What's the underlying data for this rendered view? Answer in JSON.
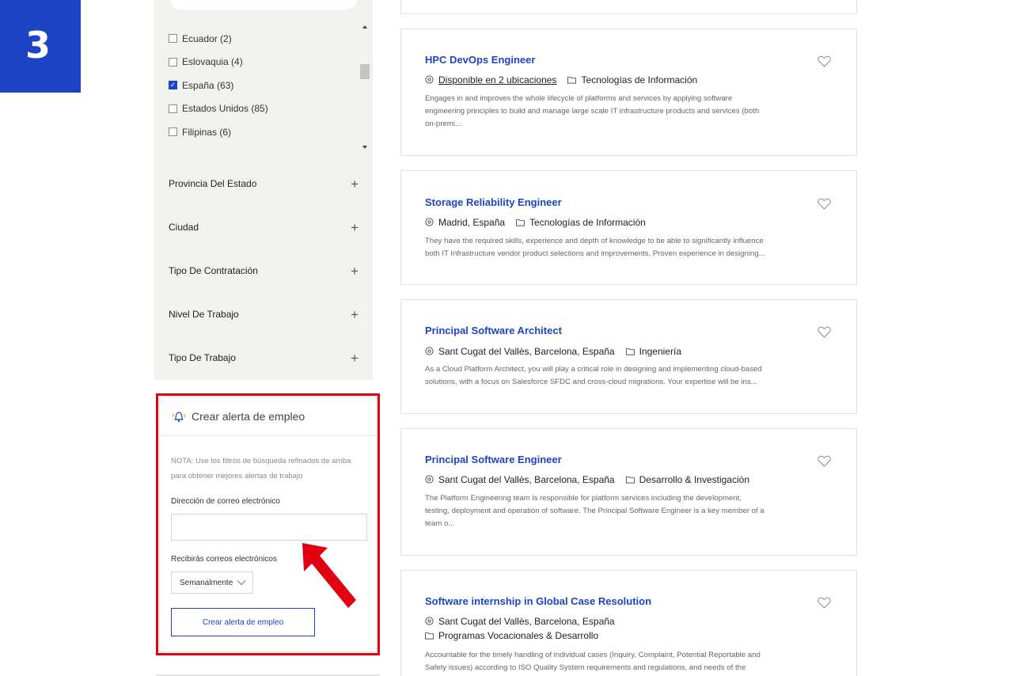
{
  "step_badge": "3",
  "countries": [
    {
      "label": "Ecuador (2)",
      "checked": false
    },
    {
      "label": "Eslovaquia (4)",
      "checked": false
    },
    {
      "label": "España (63)",
      "checked": true
    },
    {
      "label": "Estados Unidos (85)",
      "checked": false
    },
    {
      "label": "Filipinas (6)",
      "checked": false
    }
  ],
  "filters": [
    {
      "label": "Provincia Del Estado"
    },
    {
      "label": "Ciudad"
    },
    {
      "label": "Tipo De Contratación"
    },
    {
      "label": "Nivel De Trabajo"
    },
    {
      "label": "Tipo De Trabajo"
    }
  ],
  "alert": {
    "title": "Crear alerta de empleo",
    "note_line1": "NOTA: Use los filtros de búsqueda refinados de arriba",
    "note_line2": "para obtener mejores alertas de trabajo",
    "email_label": "Dirección de correo electrónico",
    "email_value": "",
    "frequency_label": "Recibirás correos electrónicos",
    "frequency_value": "Semanalmente",
    "button_label": "Crear alerta de empleo"
  },
  "jobs": [
    {
      "title": "HPC DevOps Engineer",
      "location": "Disponible en 2 ubicaciones",
      "category": "Tecnologías de Información",
      "desc": [
        "Engages in and improves the whole lifecycle of platforms and services by applying software",
        "engineering principles to build and manage large scale IT infrastructure products and services (both",
        "on-premi..."
      ]
    },
    {
      "title": "Storage Reliability Engineer",
      "location": "Madrid, España",
      "category": "Tecnologías de Información",
      "desc": [
        "They have the required skills, experience and depth of knowledge to be able to significantly influence",
        "both IT Infrastructure vendor product selections and improvements. Proven experience in designing..."
      ]
    },
    {
      "title": "Principal Software Architect",
      "location": "Sant Cugat del Vallès, Barcelona, España",
      "category": "Ingeniería",
      "desc": [
        "As a Cloud Platform Architect, you will play a critical role in designing and implementing cloud-based",
        "solutions, with a focus on Salesforce SFDC and cross-cloud migrations. Your expertise will be ins..."
      ]
    },
    {
      "title": "Principal Software Engineer",
      "location": "Sant Cugat del Vallès, Barcelona, España",
      "category": "Desarrollo & Investigación",
      "desc": [
        "The Platform Engineering team is responsible for platform services including the development,",
        "testing, deployment and operation of software. The Principal Software Engineer is a key member of a",
        "team o..."
      ]
    },
    {
      "title": "Software internship in Global Case Resolution",
      "location": "Sant Cugat del Vallès, Barcelona, España",
      "category": "Programas Vocacionales & Desarrollo",
      "desc": [
        "Accountable for the timely handling of individual cases (Inquiry, Complaint, Potential Reportable and",
        "Safety issues) according to ISO Quality System requirements and regulations, and needs of the"
      ]
    }
  ],
  "colors": {
    "brand_blue": "#1c44c4",
    "highlight_red": "#e00010",
    "sidebar_bg": "#f1f1ee"
  }
}
